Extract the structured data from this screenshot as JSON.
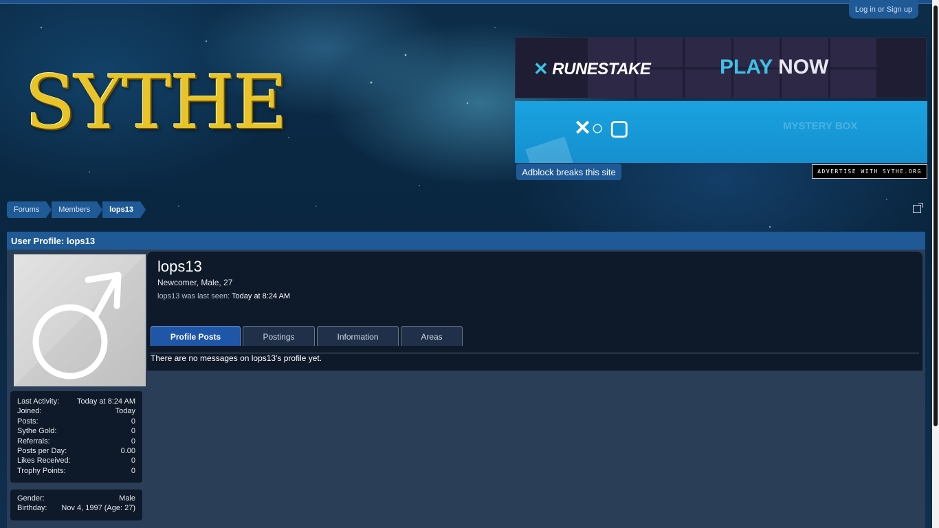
{
  "header": {
    "login_label": "Log in or Sign up",
    "logo_text": "SYTHE"
  },
  "ads": {
    "runestake_brand": "RUNESTAKE",
    "play": "PLAY",
    "now": "NOW",
    "mystery_box": "MYSTERY BOX",
    "adblock_label": "Adblock breaks this site",
    "advertise_label": "ADVERTISE WITH SYTHE.ORG"
  },
  "breadcrumb": [
    "Forums",
    "Members",
    "lops13"
  ],
  "page": {
    "title": "User Profile: lops13"
  },
  "profile": {
    "username": "lops13",
    "blurb": "Newcomer, Male, 27",
    "last_seen_label": "lops13 was last seen:",
    "last_seen_value": "Today at 8:24 AM",
    "avatar_icon": "male-symbol-icon"
  },
  "stats": [
    {
      "label": "Last Activity:",
      "value": "Today at 8:24 AM"
    },
    {
      "label": "Joined:",
      "value": "Today"
    },
    {
      "label": "Posts:",
      "value": "0"
    },
    {
      "label": "Sythe Gold:",
      "value": "0"
    },
    {
      "label": "Referrals:",
      "value": "0"
    },
    {
      "label": "Posts per Day:",
      "value": "0.00"
    },
    {
      "label": "Likes Received:",
      "value": "0"
    },
    {
      "label": "Trophy Points:",
      "value": "0"
    }
  ],
  "personal": [
    {
      "label": "Gender:",
      "value": "Male"
    },
    {
      "label": "Birthday:",
      "value": "Nov 4, 1997 (Age: 27)"
    }
  ],
  "tabs": [
    {
      "label": "Profile Posts",
      "active": true
    },
    {
      "label": "Postings",
      "active": false
    },
    {
      "label": "Information",
      "active": false
    },
    {
      "label": "Areas",
      "active": false
    }
  ],
  "profile_posts": {
    "empty_message": "There are no messages on lops13's profile yet."
  },
  "colors": {
    "accent_blue": "#1f5a96",
    "panel_dark": "#0e1a2a",
    "content_bg": "#2b3e57",
    "logo_gold": "#e8c428"
  }
}
